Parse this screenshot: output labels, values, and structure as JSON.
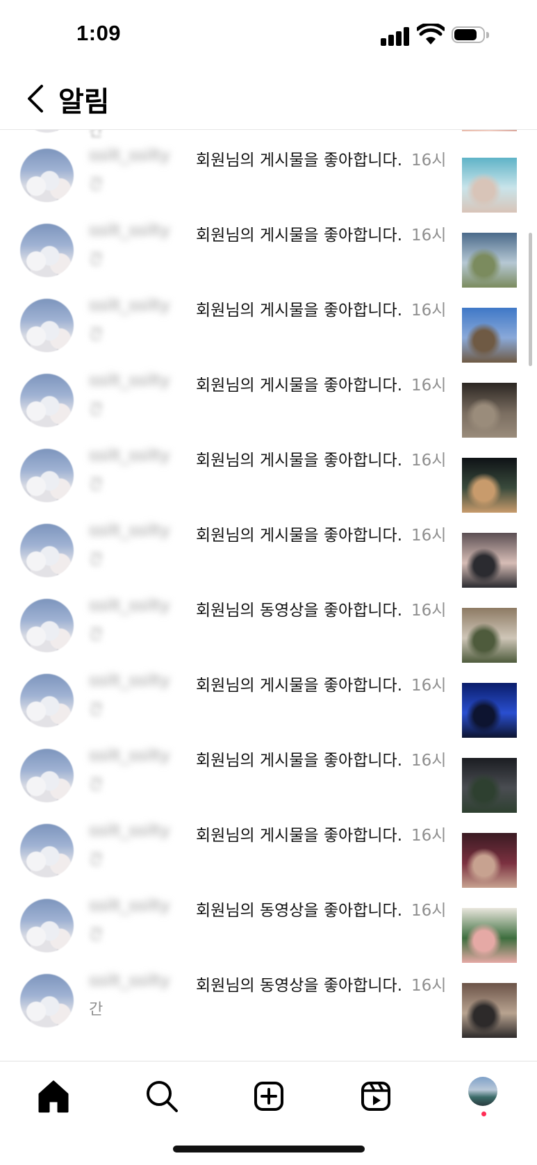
{
  "status_bar": {
    "time": "1:09"
  },
  "header": {
    "title": "알림"
  },
  "partial_first_item": {
    "line2": "간"
  },
  "notifications": [
    {
      "username": "ssilt_ssilty",
      "line2": "간",
      "message": "회원님의 게시물을 좋아합니다.",
      "time": "16시",
      "thumb_colors": [
        "#5fb3c7",
        "#c9e4ea",
        "#d8c4b8"
      ]
    },
    {
      "username": "ssilt_ssilty",
      "line2": "간",
      "message": "회원님의 게시물을 좋아합니다.",
      "time": "16시",
      "thumb_colors": [
        "#4b6a8a",
        "#b6c8d4",
        "#7b8b5e"
      ]
    },
    {
      "username": "ssilt_ssilty",
      "line2": "간",
      "message": "회원님의 게시물을 좋아합니다.",
      "time": "16시",
      "thumb_colors": [
        "#3f78c7",
        "#8aa9d9",
        "#6f5a44"
      ]
    },
    {
      "username": "ssilt_ssilty",
      "line2": "간",
      "message": "회원님의 게시물을 좋아합니다.",
      "time": "16시",
      "thumb_colors": [
        "#2b2622",
        "#7a6d60",
        "#9a8c7b"
      ]
    },
    {
      "username": "ssilt_ssilty",
      "line2": "간",
      "message": "회원님의 게시물을 좋아합니다.",
      "time": "16시",
      "thumb_colors": [
        "#0e1216",
        "#3a4b3c",
        "#c89b6c"
      ]
    },
    {
      "username": "ssilt_ssilty",
      "line2": "간",
      "message": "회원님의 게시물을 좋아합니다.",
      "time": "16시",
      "thumb_colors": [
        "#5b4f53",
        "#d7bdb6",
        "#2b2b30"
      ]
    },
    {
      "username": "ssilt_ssilty",
      "line2": "간",
      "message": "회원님의 동영상을 좋아합니다.",
      "time": "16시",
      "thumb_colors": [
        "#8d7a63",
        "#cfc6b8",
        "#4e5b3c"
      ]
    },
    {
      "username": "ssilt_ssilty",
      "line2": "간",
      "message": "회원님의 게시물을 좋아합니다.",
      "time": "16시",
      "thumb_colors": [
        "#0a1d6a",
        "#2a4fd0",
        "#0d1430"
      ]
    },
    {
      "username": "ssilt_ssilty",
      "line2": "간",
      "message": "회원님의 게시물을 좋아합니다.",
      "time": "16시",
      "thumb_colors": [
        "#1b1d22",
        "#4a4d52",
        "#2e4030"
      ]
    },
    {
      "username": "ssilt_ssilty",
      "line2": "간",
      "message": "회원님의 게시물을 좋아합니다.",
      "time": "16시",
      "thumb_colors": [
        "#3a1a22",
        "#7b3140",
        "#c7a290"
      ]
    },
    {
      "username": "ssilt_ssilty",
      "line2": "간",
      "message": "회원님의 동영상을 좋아합니다.",
      "time": "16시",
      "thumb_colors": [
        "#e9e6dd",
        "#3d6e3e",
        "#e5a9a5"
      ]
    },
    {
      "username": "ssilt_ssilty",
      "line2": "간",
      "message": "회원님의 동영상을 좋아합니다.",
      "time": "16시",
      "thumb_colors": [
        "#6b5348",
        "#b8a390",
        "#2d2a2a"
      ]
    }
  ],
  "last_line2_visible": "간",
  "tab_bar": {
    "tabs": [
      {
        "icon": "home-icon"
      },
      {
        "icon": "search-icon"
      },
      {
        "icon": "create-post-icon"
      },
      {
        "icon": "reels-icon"
      },
      {
        "icon": "profile-avatar"
      }
    ],
    "notification_dot_color": "#ff2d55"
  }
}
